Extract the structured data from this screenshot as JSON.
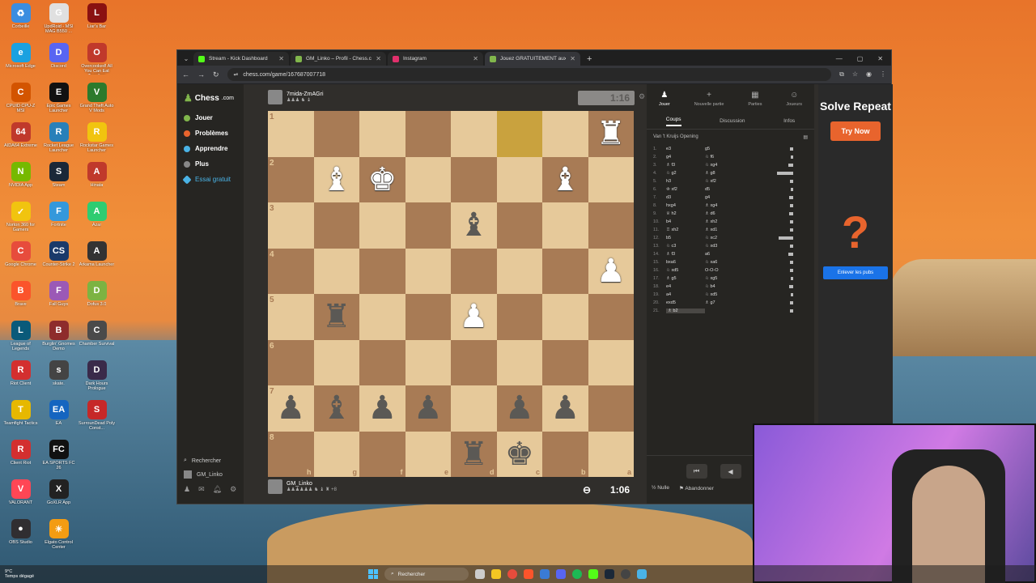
{
  "desktop": {
    "icons": [
      {
        "label": "Corbeille",
        "color": "#3a8de0",
        "glyph": "♻"
      },
      {
        "label": "UpdRoid - MSI MAG B550 ...",
        "color": "#e0e0e0",
        "glyph": "G"
      },
      {
        "label": "Liar's Bar",
        "color": "#8a1111",
        "glyph": "L"
      },
      {
        "label": "Microsoft Edge",
        "color": "#1aa1e0",
        "glyph": "e"
      },
      {
        "label": "Discord",
        "color": "#5865f2",
        "glyph": "D"
      },
      {
        "label": "Overcooked! All You Can Eat Together",
        "color": "#c0392b",
        "glyph": "O"
      },
      {
        "label": "CPUID CPU-Z MSI",
        "color": "#d35400",
        "glyph": "C"
      },
      {
        "label": "Epic Games Launcher",
        "color": "#111",
        "glyph": "E"
      },
      {
        "label": "Grand Theft Auto V Mods",
        "color": "#2c7a2c",
        "glyph": "V"
      },
      {
        "label": "AIDA64 Extreme",
        "color": "#c0392b",
        "glyph": "64"
      },
      {
        "label": "Rocket League Launcher",
        "color": "#2980b9",
        "glyph": "R"
      },
      {
        "label": "Rockstar Games Launcher",
        "color": "#f1c40f",
        "glyph": "R"
      },
      {
        "label": "NVIDIA App",
        "color": "#76b900",
        "glyph": "N"
      },
      {
        "label": "Steam",
        "color": "#1b2838",
        "glyph": "S"
      },
      {
        "label": "Hinata",
        "color": "#c0392b",
        "glyph": "A"
      },
      {
        "label": "Norton 360 for Gamers",
        "color": "#f1c40f",
        "glyph": "✓"
      },
      {
        "label": "Fortnite",
        "color": "#3498db",
        "glyph": "F"
      },
      {
        "label": "Azar",
        "color": "#2ecc71",
        "glyph": "A"
      },
      {
        "label": "Google Chrome",
        "color": "#e74c3c",
        "glyph": "C"
      },
      {
        "label": "Counter-Strike 2",
        "color": "#1a3a6a",
        "glyph": "CS"
      },
      {
        "label": "Arkama Launcher",
        "color": "#333",
        "glyph": "A"
      },
      {
        "label": "Brave",
        "color": "#fb542b",
        "glyph": "B"
      },
      {
        "label": "Fall Guys",
        "color": "#9b59b6",
        "glyph": "F"
      },
      {
        "label": "Dofus 3.0",
        "color": "#7cb342",
        "glyph": "D"
      },
      {
        "label": "League of Legends",
        "color": "#0a5a7a",
        "glyph": "L"
      },
      {
        "label": "Burglin' Gnomes Demo",
        "color": "#8e2c2c",
        "glyph": "B"
      },
      {
        "label": "Chamber Survival",
        "color": "#4a4a4a",
        "glyph": "C"
      },
      {
        "label": "Riot Client",
        "color": "#d32f2f",
        "glyph": "R"
      },
      {
        "label": "skate.",
        "color": "#444",
        "glyph": "s"
      },
      {
        "label": "Dark Hours Prologue",
        "color": "#3a2a4a",
        "glyph": "D"
      },
      {
        "label": "Teamfight Tactics",
        "color": "#e6b800",
        "glyph": "T"
      },
      {
        "label": "EA",
        "color": "#1565c0",
        "glyph": "EA"
      },
      {
        "label": "SurrounDead Poly Const...",
        "color": "#c62828",
        "glyph": "S"
      },
      {
        "label": "Client Riot",
        "color": "#d32f2f",
        "glyph": "R"
      },
      {
        "label": "EA SPORTS FC 26",
        "color": "#111",
        "glyph": "FC"
      },
      {
        "label": "",
        "color": "transparent",
        "glyph": ""
      },
      {
        "label": "VALORANT",
        "color": "#ff4655",
        "glyph": "V"
      },
      {
        "label": "GoXLR App",
        "color": "#222",
        "glyph": "X"
      },
      {
        "label": "",
        "color": "transparent",
        "glyph": ""
      },
      {
        "label": "OBS Studio",
        "color": "#302e31",
        "glyph": "●"
      },
      {
        "label": "Elgato Control Center",
        "color": "#f39c12",
        "glyph": "☀"
      }
    ]
  },
  "browser": {
    "tabs": [
      {
        "title": "Stream - Kick Dashboard",
        "color": "#53fc18",
        "active": false
      },
      {
        "title": "GM_Linko – Profil - Chess.com",
        "color": "#81b64c",
        "active": false
      },
      {
        "title": "Instagram",
        "color": "#e1306c",
        "active": false
      },
      {
        "title": "Jouez GRATUITEMENT aux ...",
        "color": "#81b64c",
        "active": true
      }
    ],
    "url": "chess.com/game/167687007718"
  },
  "chesscom": {
    "logo": "Chess",
    "logo_suffix": ".com",
    "nav": [
      {
        "label": "Jouer",
        "color": "#81b64c"
      },
      {
        "label": "Problèmes",
        "color": "#e8642d"
      },
      {
        "label": "Apprendre",
        "color": "#4ab3e6"
      },
      {
        "label": "Plus",
        "color": "#888"
      }
    ],
    "trial": "Essai gratuit",
    "search": "Rechercher",
    "user": "GM_Linko"
  },
  "game": {
    "opponent": {
      "name": "7mida-ZmAGri",
      "sub": "♟♟♟ ♞ ♝"
    },
    "me": {
      "name": "GM_Linko",
      "sub": "♟♟♟♟♟♟ ♞ ♝ ♜ +8"
    },
    "clock_top": "1:16",
    "clock_bottom": "1:06",
    "ranks": [
      "1",
      "2",
      "3",
      "4",
      "5",
      "6",
      "7",
      "8"
    ],
    "files": [
      "h",
      "g",
      "f",
      "e",
      "d",
      "c",
      "b",
      "a"
    ],
    "board": [
      [
        "",
        "",
        "",
        "",
        "",
        "",
        "",
        "wR"
      ],
      [
        "",
        "wB",
        "wK",
        "",
        "",
        "",
        "wB",
        ""
      ],
      [
        "",
        "",
        "",
        "",
        "bB",
        "",
        "",
        ""
      ],
      [
        "",
        "",
        "",
        "",
        "",
        "",
        "",
        "wP"
      ],
      [
        "",
        "bR",
        "",
        "",
        "wP",
        "",
        "",
        ""
      ],
      [
        "",
        "",
        "",
        "",
        "",
        "",
        "",
        ""
      ],
      [
        "bP",
        "bB",
        "bP",
        "bP",
        "",
        "bP",
        "bP",
        ""
      ],
      [
        "",
        "",
        "",
        "",
        "bR",
        "bK",
        "",
        ""
      ]
    ],
    "highlight": [
      [
        0,
        5
      ]
    ]
  },
  "side": {
    "tabs": [
      {
        "label": "Jouer",
        "icon": "♟",
        "active": true
      },
      {
        "label": "Nouvelle partie",
        "icon": "+",
        "active": false
      },
      {
        "label": "Parties",
        "icon": "▦",
        "active": false
      },
      {
        "label": "Joueurs",
        "icon": "☺",
        "active": false
      }
    ],
    "subtabs": [
      "Coups",
      "Discussion",
      "Infos"
    ],
    "opening": "Van 't Kruijs Opening",
    "moves": [
      {
        "n": "1.",
        "w": "e3",
        "b": "g5",
        "bar": 4
      },
      {
        "n": "2.",
        "w": "g4",
        "b": "♘ f6",
        "bar": 3
      },
      {
        "n": "3.",
        "w": "♗ f3",
        "b": "♘ xg4",
        "bar": 6
      },
      {
        "n": "4.",
        "w": "♘ g2",
        "b": "♗ g8",
        "bar": 20
      },
      {
        "n": "5.",
        "w": "h3",
        "b": "♘ xf2",
        "bar": 4
      },
      {
        "n": "6.",
        "w": "♔ xf2",
        "b": "d5",
        "bar": 3
      },
      {
        "n": "7.",
        "w": "d3",
        "b": "g4",
        "bar": 5
      },
      {
        "n": "8.",
        "w": "hxg4",
        "b": "♗ xg4",
        "bar": 4
      },
      {
        "n": "9.",
        "w": "♕ h2",
        "b": "♗ d6",
        "bar": 5
      },
      {
        "n": "10.",
        "w": "b4",
        "b": "♗ xh2",
        "bar": 4
      },
      {
        "n": "11.",
        "w": "♖ xh2",
        "b": "♗ xd1",
        "bar": 4
      },
      {
        "n": "12.",
        "w": "b5",
        "b": "♘ xc2",
        "bar": 18
      },
      {
        "n": "13.",
        "w": "♘ c3",
        "b": "♘ xd3",
        "bar": 4
      },
      {
        "n": "14.",
        "w": "♗ f3",
        "b": "a6",
        "bar": 6
      },
      {
        "n": "15.",
        "w": "bxa6",
        "b": "♘ xa6",
        "bar": 4
      },
      {
        "n": "16.",
        "w": "♘ xd5",
        "b": "O-O-O",
        "bar": 4
      },
      {
        "n": "17.",
        "w": "♗ g5",
        "b": "♘ xg5",
        "bar": 3
      },
      {
        "n": "18.",
        "w": "e4",
        "b": "♘ b4",
        "bar": 5
      },
      {
        "n": "19.",
        "w": "a4",
        "b": "♘ xd5",
        "bar": 3
      },
      {
        "n": "20.",
        "w": "exd5",
        "b": "♗ g7",
        "bar": 4
      },
      {
        "n": "21.",
        "w": "♗ b2",
        "b": "",
        "bar": 4
      }
    ],
    "draw": "Nulle",
    "resign": "Abandonner"
  },
  "ad": {
    "title": "Solve Repeat",
    "cta": "Try Now",
    "remove": "Enlever les pubs"
  },
  "taskbar": {
    "temp": "9°C",
    "weather": "Temps dégagé",
    "search": "Rechercher"
  }
}
